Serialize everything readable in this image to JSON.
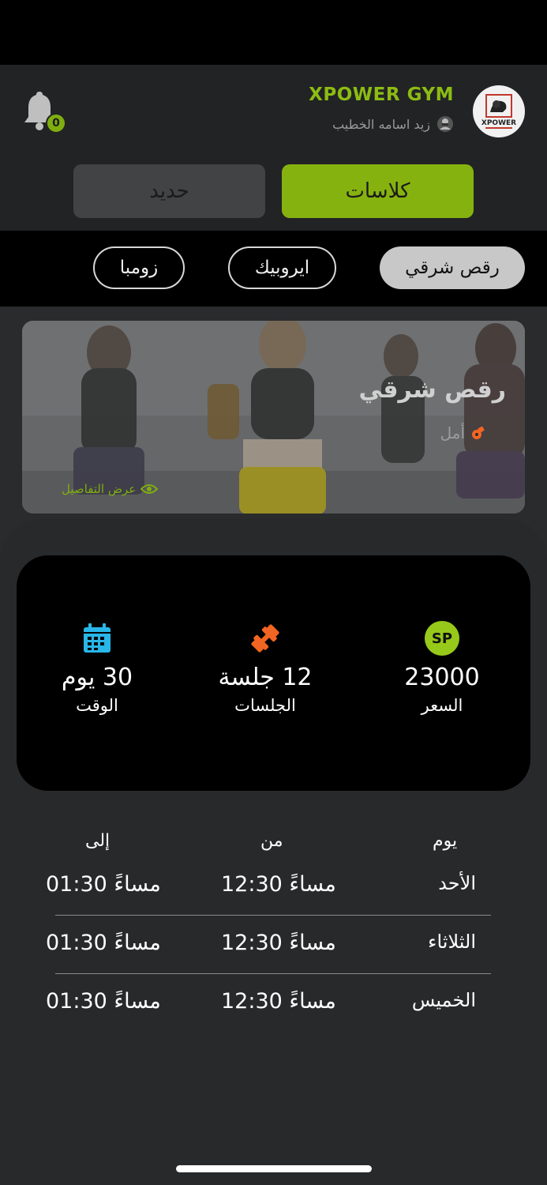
{
  "header": {
    "gym_name": "XPOWER GYM",
    "user_name": "زيد اسامه الخطيب",
    "notification_count": "0",
    "logo_text": "XPOWER"
  },
  "tabs": [
    {
      "label": "كلاسات",
      "active": true
    },
    {
      "label": "حديد",
      "active": false
    }
  ],
  "chips": [
    {
      "label": "رقص شرقي",
      "selected": true
    },
    {
      "label": "ايروبيك",
      "selected": false
    },
    {
      "label": "زومبا",
      "selected": false
    }
  ],
  "class_card": {
    "title": "رقص شرقي",
    "coach": "أمل",
    "details_label": "عرض التفاصيل"
  },
  "info": {
    "price_badge": "SP",
    "price_value": "23000",
    "price_label": "السعر",
    "sessions_value": "12 جلسة",
    "sessions_label": "الجلسات",
    "time_value": "30 يوم",
    "time_label": "الوقت"
  },
  "schedule": {
    "headers": {
      "day": "يوم",
      "from": "من",
      "to": "إلى"
    },
    "rows": [
      {
        "day": "الأحد",
        "from": "12:30 مساءً",
        "to": "01:30 مساءً"
      },
      {
        "day": "الثلاثاء",
        "from": "12:30 مساءً",
        "to": "01:30 مساءً"
      },
      {
        "day": "الخميس",
        "from": "12:30 مساءً",
        "to": "01:30 مساءً"
      }
    ]
  },
  "colors": {
    "accent": "#86b20f",
    "background": "#2a2b2d",
    "card": "#000000",
    "sessions_icon": "#f26522",
    "time_icon": "#29b6e8"
  }
}
